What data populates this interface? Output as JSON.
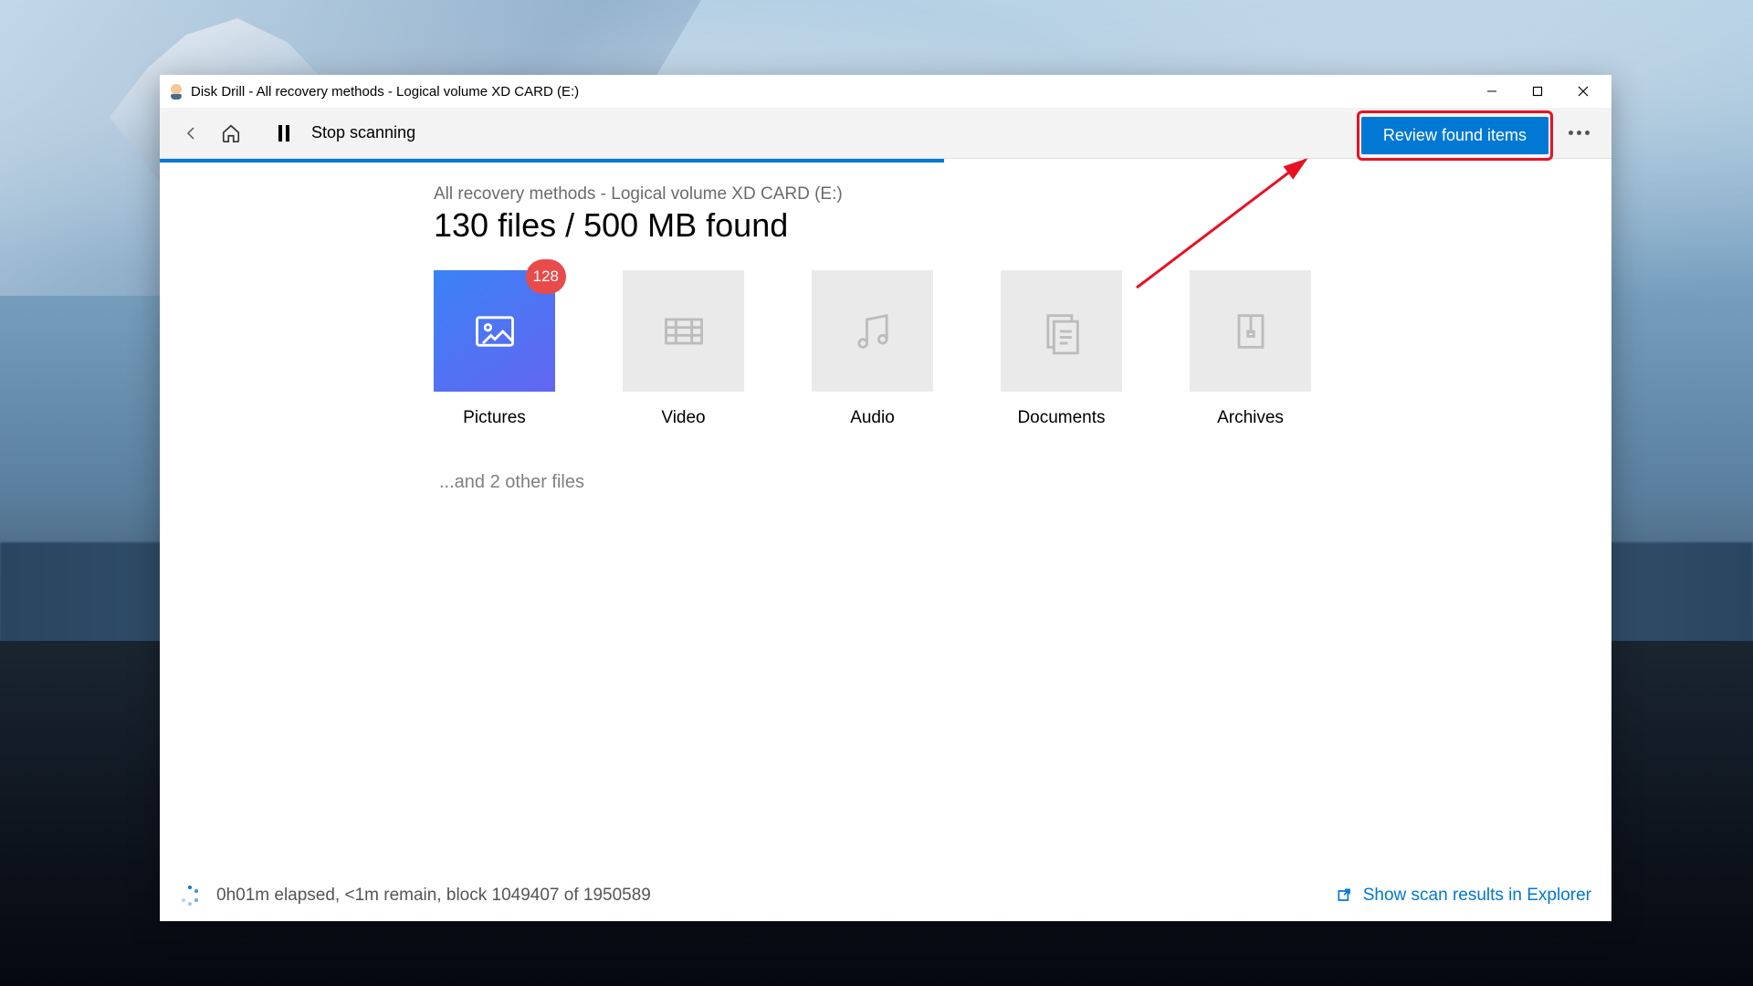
{
  "window": {
    "title": "Disk Drill - All recovery methods - Logical volume XD CARD (E:)"
  },
  "toolbar": {
    "stop_label": "Stop scanning",
    "review_label": "Review found items"
  },
  "progress": {
    "percent": 54
  },
  "content": {
    "subtitle": "All recovery methods - Logical volume XD CARD (E:)",
    "headline": "130 files / 500 MB found",
    "other_files": "...and 2 other files"
  },
  "categories": [
    {
      "label": "Pictures",
      "badge": 128,
      "active": true,
      "icon": "image"
    },
    {
      "label": "Video",
      "icon": "video"
    },
    {
      "label": "Audio",
      "icon": "audio"
    },
    {
      "label": "Documents",
      "icon": "document"
    },
    {
      "label": "Archives",
      "icon": "archive"
    }
  ],
  "footer": {
    "status": "0h01m elapsed, <1m remain, block 1049407 of 1950589",
    "explorer_link": "Show scan results in Explorer"
  }
}
